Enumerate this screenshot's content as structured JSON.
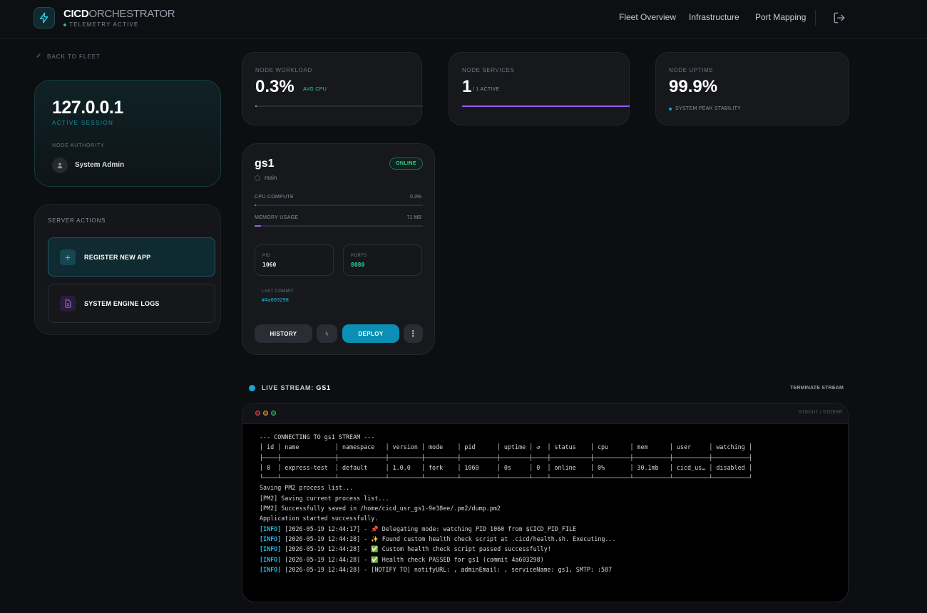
{
  "header": {
    "brand_bold": "CICD",
    "brand_light": "ORCHESTRATOR",
    "telemetry": "TELEMETRY ACTIVE",
    "nav": [
      "Fleet Overview",
      "Infrastructure",
      "Port Mapping"
    ]
  },
  "back_label": "BACK TO FLEET",
  "session": {
    "ip": "127.0.0.1",
    "status": "ACTIVE SESSION",
    "authority_label": "NODE AUTHORITY",
    "admin": "System Admin"
  },
  "actions": {
    "title": "SERVER ACTIONS",
    "register": "REGISTER NEW APP",
    "logs": "SYSTEM ENGINE LOGS"
  },
  "stats": {
    "workload": {
      "label": "NODE WORKLOAD",
      "value": "0.3%",
      "sub": "AVG CPU",
      "fill": 0.003
    },
    "services": {
      "label": "NODE SERVICES",
      "value": "1",
      "sub": "/ 1 ACTIVE",
      "fill": 1.0
    },
    "uptime": {
      "label": "NODE UPTIME",
      "value": "99.9%",
      "sub": "SYSTEM PEAK STABILITY"
    }
  },
  "app": {
    "name": "gs1",
    "status": "ONLINE",
    "branch": "main",
    "cpu_label": "CPU COMPUTE",
    "cpu_value": "0.3%",
    "cpu_fill": 0.003,
    "mem_label": "MEMORY USAGE",
    "mem_value": "71 MB",
    "mem_fill": 0.04,
    "pid_label": "PID",
    "pid": "1060",
    "ports_label": "PORTS",
    "ports": "8080",
    "commit_label": "LAST COMMIT",
    "commit": "#4a603298",
    "btn_history": "HISTORY",
    "btn_bolt": "ϟ",
    "btn_deploy": "DEPLOY",
    "btn_more": "⋮"
  },
  "stream": {
    "title": "LIVE STREAM:",
    "app": "GS1",
    "terminate": "TERMINATE STREAM",
    "tag": "STDOUT / STDERR"
  },
  "terminal": {
    "lines": [
      "--- CONNECTING TO gs1 STREAM ---",
      "│ id │ name          │ namespace   │ version │ mode    │ pid      │ uptime │ ↺  │ status    │ cpu      │ mem      │ user     │ watching │",
      "├────┼───────────────┼─────────────┼─────────┼─────────┼──────────┼────────┼────┼───────────┼──────────┼──────────┼──────────┼──────────┤",
      "│ 0  │ express-test  │ default     │ 1.0.0   │ fork    │ 1060     │ 0s     │ 0  │ online    │ 0%       │ 30.1mb   │ cicd_us… │ disabled │",
      "└────┴───────────────┴─────────────┴─────────┴─────────┴──────────┴────────┴────┴───────────┴──────────┴──────────┴──────────┴──────────┘",
      "Saving PM2 process list...",
      "[PM2] Saving current process list...",
      "[PM2] Successfully saved in /home/cicd_usr_gs1-9e38ee/.pm2/dump.pm2",
      "Application started successfully."
    ],
    "info_lines": [
      "[2026-05-19 12:44:17] - 📌 Delegating mode: watching PID 1060 from $CICD_PID_FILE",
      "[2026-05-19 12:44:28] - ✨ Found custom health check script at .cicd/health.sh. Executing...",
      "[2026-05-19 12:44:28] - ✅ Custom health check script passed successfully!",
      "[2026-05-19 12:44:28] - ✅ Health check PASSED for gs1 (commit 4a603298)",
      "[2026-05-19 12:44:28] - [NOTIFY TO] notifyURL: , adminEmail: , serviceName: gs1, SMTP: :587"
    ],
    "info_tag": "[INFO]"
  },
  "colors": {
    "accent": "#0b8fb4",
    "online": "#2ed39c",
    "purple": "#9b59f5"
  }
}
